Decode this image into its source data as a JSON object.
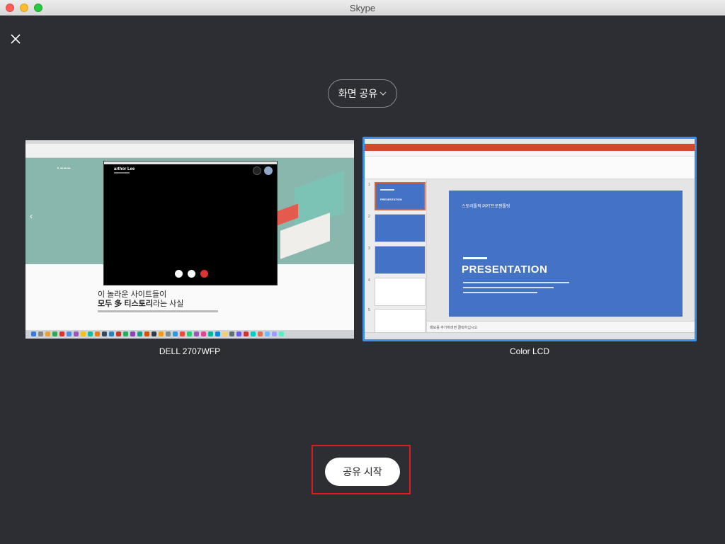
{
  "window": {
    "title": "Skype"
  },
  "share_dropdown": {
    "label": "화면 공유"
  },
  "screens": [
    {
      "label": "DELL 2707WFP",
      "thumbnail": {
        "call_name": "arthor Lee",
        "headline_line1": "이 놀라운 사이트들이",
        "headline_line2_bold": "모두 多 티스토리",
        "headline_line2_rest": "라는 사실"
      }
    },
    {
      "label": "Color LCD",
      "selected": true,
      "thumbnail": {
        "slide_subtitle": "스토리툴픽 PPT프로젠툴팅",
        "slide_title": "PRESENTATION",
        "mini_title": "PRESENTATION",
        "notes": "메모를 추가하려면 클릭하십시오"
      }
    }
  ],
  "start_share": {
    "label": "공유 시작"
  },
  "colors": {
    "background": "#2d2e33",
    "selection": "#3b8fe8",
    "highlight": "#e11b1b",
    "slide_blue": "#4472c4"
  }
}
